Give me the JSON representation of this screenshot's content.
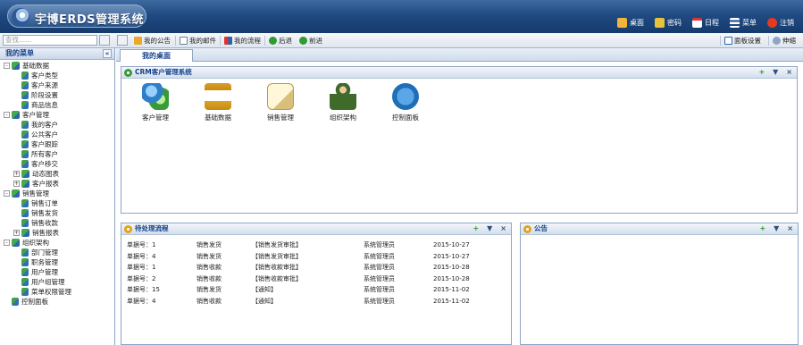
{
  "header": {
    "app_title": "宇博ERDS管理系统",
    "nav": [
      {
        "label": "桌面",
        "icon": "home-icon"
      },
      {
        "label": "密码",
        "icon": "lock-icon"
      },
      {
        "label": "日程",
        "icon": "calendar-icon"
      },
      {
        "label": "菜单",
        "icon": "menu-icon"
      },
      {
        "label": "注销",
        "icon": "logout-icon"
      }
    ]
  },
  "toolbar": {
    "search_placeholder": "查找......",
    "items": [
      {
        "label": "我的公告",
        "icon": "announcement-icon"
      },
      {
        "label": "我的邮件",
        "icon": "mail-icon"
      },
      {
        "label": "我的流程",
        "icon": "workflow-icon"
      },
      {
        "label": "后退",
        "icon": "back-icon"
      },
      {
        "label": "前进",
        "icon": "forward-icon"
      }
    ],
    "right_items": [
      {
        "label": "面板设置",
        "icon": "panel-settings-icon"
      },
      {
        "label": "伸缩",
        "icon": "expand-icon"
      }
    ]
  },
  "sidebar": {
    "title": "我的菜单",
    "collapse_glyph": "«",
    "tree": [
      {
        "label": "基础数据",
        "level": 0,
        "type": "folder",
        "toggle": "-"
      },
      {
        "label": "客户类型",
        "level": 1,
        "type": "leaf"
      },
      {
        "label": "客户来源",
        "level": 1,
        "type": "leaf"
      },
      {
        "label": "阶段设置",
        "level": 1,
        "type": "leaf"
      },
      {
        "label": "商品信息",
        "level": 1,
        "type": "leaf"
      },
      {
        "label": "客户管理",
        "level": 0,
        "type": "folder",
        "toggle": "-"
      },
      {
        "label": "我的客户",
        "level": 1,
        "type": "leaf"
      },
      {
        "label": "公共客户",
        "level": 1,
        "type": "leaf"
      },
      {
        "label": "客户跟踪",
        "level": 1,
        "type": "leaf"
      },
      {
        "label": "所有客户",
        "level": 1,
        "type": "leaf"
      },
      {
        "label": "客户移交",
        "level": 1,
        "type": "leaf"
      },
      {
        "label": "动态图表",
        "level": 1,
        "type": "folder",
        "toggle": "+"
      },
      {
        "label": "客户报表",
        "level": 1,
        "type": "folder",
        "toggle": "+"
      },
      {
        "label": "销售管理",
        "level": 0,
        "type": "folder",
        "toggle": "-"
      },
      {
        "label": "销售订单",
        "level": 1,
        "type": "leaf"
      },
      {
        "label": "销售发货",
        "level": 1,
        "type": "leaf"
      },
      {
        "label": "销售收款",
        "level": 1,
        "type": "leaf"
      },
      {
        "label": "销售报表",
        "level": 1,
        "type": "folder",
        "toggle": "+"
      },
      {
        "label": "组织架构",
        "level": 0,
        "type": "folder",
        "toggle": "-"
      },
      {
        "label": "部门管理",
        "level": 1,
        "type": "leaf"
      },
      {
        "label": "职务管理",
        "level": 1,
        "type": "leaf"
      },
      {
        "label": "用户管理",
        "level": 1,
        "type": "leaf"
      },
      {
        "label": "用户组管理",
        "level": 1,
        "type": "leaf"
      },
      {
        "label": "菜单权限管理",
        "level": 1,
        "type": "leaf"
      },
      {
        "label": "控制面板",
        "level": 0,
        "type": "leaf"
      }
    ]
  },
  "main": {
    "tab_label": "我的桌面",
    "crm_panel": {
      "title": "CRM客户管理系统",
      "controls": [
        "+",
        "▼",
        "×"
      ],
      "apps": [
        {
          "label": "客户管理",
          "icon": "users-icon",
          "color": "#3b8fd6"
        },
        {
          "label": "基础数据",
          "icon": "padlock-icon",
          "color": "#e1a21a"
        },
        {
          "label": "销售管理",
          "icon": "sales-doc-icon",
          "color": "#d8c07a"
        },
        {
          "label": "组织架构",
          "icon": "soldier-icon",
          "color": "#3f6b2a"
        },
        {
          "label": "控制面板",
          "icon": "tools-icon",
          "color": "#1f6fb8"
        }
      ]
    },
    "flow_panel": {
      "title": "待处理流程",
      "controls": [
        "+",
        "▼",
        "×"
      ],
      "rows": [
        [
          "单据号：1",
          "销售发货",
          "【销售发货审批】",
          "系统管理员",
          "2015-10-27"
        ],
        [
          "单据号：4",
          "销售发货",
          "【销售发货审批】",
          "系统管理员",
          "2015-10-27"
        ],
        [
          "单据号：1",
          "销售收款",
          "【销售收款审批】",
          "系统管理员",
          "2015-10-28"
        ],
        [
          "单据号：2",
          "销售收款",
          "【销售收款审批】",
          "系统管理员",
          "2015-10-28"
        ],
        [
          "单据号：15",
          "销售发货",
          "【通知】",
          "系统管理员",
          "2015-11-02"
        ],
        [
          "单据号：4",
          "销售收款",
          "【通知】",
          "系统管理员",
          "2015-11-02"
        ]
      ]
    },
    "notice_panel": {
      "title": "公告",
      "controls": [
        "+",
        "▼",
        "×"
      ]
    }
  },
  "colors": {
    "header_dark": "#163b6c",
    "accent_blue": "#15428b",
    "border": "#8ea6c4"
  }
}
